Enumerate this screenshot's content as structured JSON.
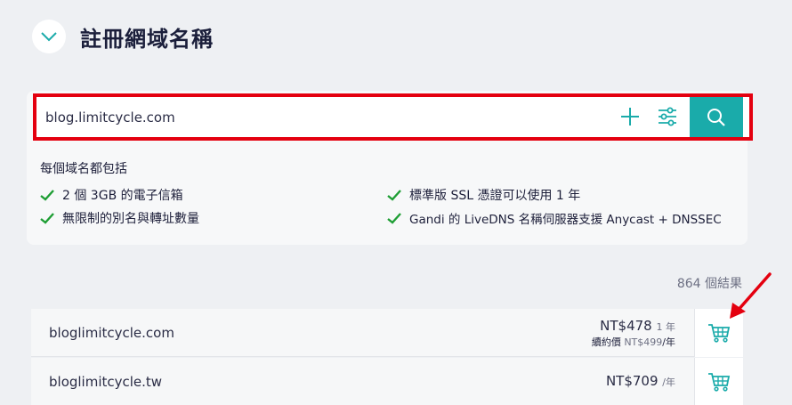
{
  "header": {
    "title": "註冊網域名稱"
  },
  "search": {
    "value": "blog.limitcycle.com"
  },
  "includes": {
    "title": "每個域名都包括",
    "features": [
      "2 個 3GB 的電子信箱",
      "標準版 SSL 憑證可以使用 1 年",
      "無限制的別名與轉址數量",
      "Gandi 的 LiveDNS 名稱伺服器支援 Anycast + DNSSEC"
    ]
  },
  "results": {
    "count_label": "864 個結果",
    "rows": [
      {
        "domain": "bloglimitcycle.com",
        "price": "NT$478",
        "price_unit": "1 年",
        "renew_label": "續約價",
        "renew_price": "NT$499",
        "renew_unit": "/年"
      },
      {
        "domain": "bloglimitcycle.tw",
        "price": "NT$709",
        "price_unit": "/年"
      }
    ]
  },
  "colors": {
    "accent": "#1aabaa",
    "highlight": "#e4000f",
    "check": "#1e9e34",
    "title": "#1b1f3b"
  },
  "icons": {
    "collapse": "chevron-down-icon",
    "add": "plus-icon",
    "filter": "sliders-icon",
    "search": "search-icon",
    "cart": "cart-icon",
    "check": "checkmark-icon"
  }
}
